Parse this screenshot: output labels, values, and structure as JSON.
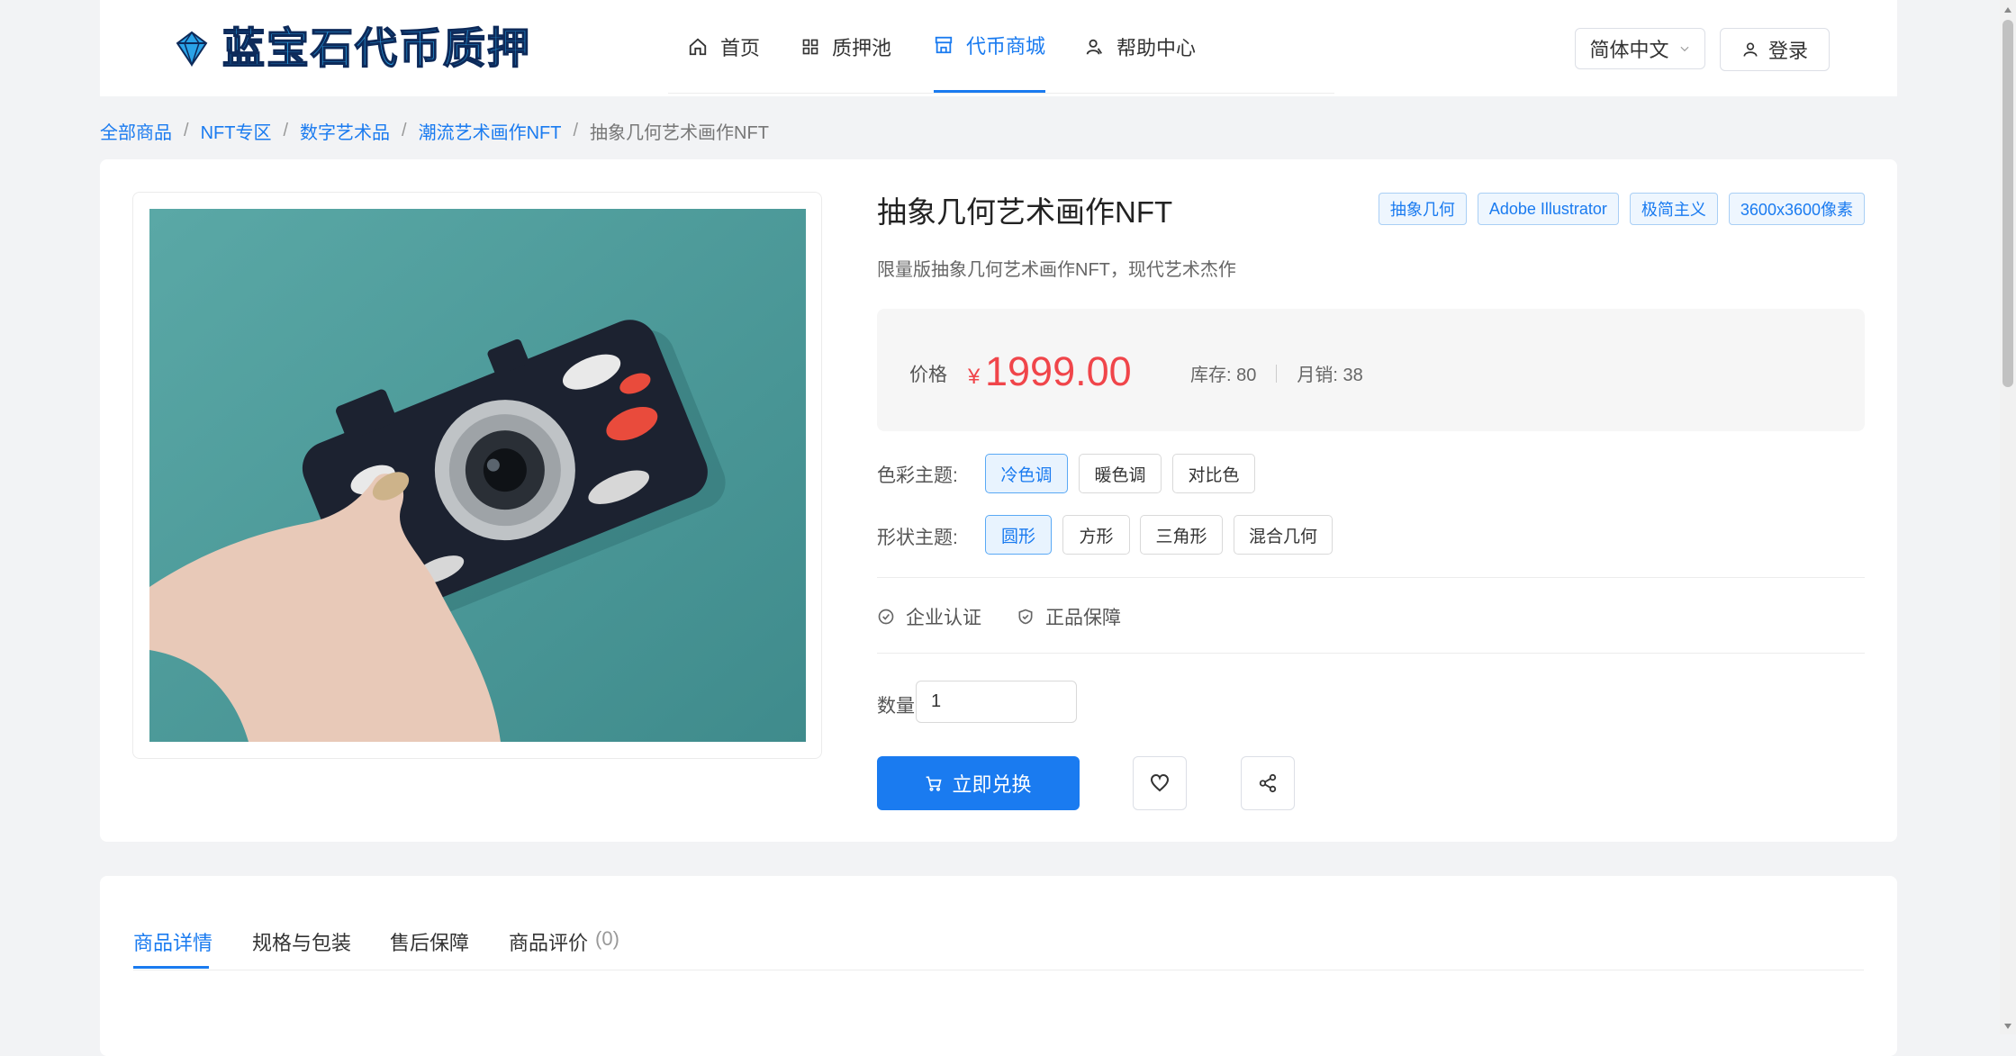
{
  "header": {
    "logo_text": "蓝宝石代币质押",
    "nav": [
      {
        "label": "首页",
        "icon": "home-icon"
      },
      {
        "label": "质押池",
        "icon": "grid-icon"
      },
      {
        "label": "代币商城",
        "icon": "store-icon",
        "active": true
      },
      {
        "label": "帮助中心",
        "icon": "support-icon"
      }
    ],
    "language": "简体中文",
    "login": "登录"
  },
  "breadcrumb": {
    "items": [
      "全部商品",
      "NFT专区",
      "数字艺术品",
      "潮流艺术画作NFT"
    ],
    "current": "抽象几何艺术画作NFT",
    "separator": "/"
  },
  "product": {
    "title": "抽象几何艺术画作NFT",
    "tags": [
      "抽象几何",
      "Adobe Illustrator",
      "极简主义",
      "3600x3600像素"
    ],
    "subtitle": "限量版抽象几何艺术画作NFT，现代艺术杰作",
    "price_label": "价格",
    "currency": "¥",
    "price": "1999.00",
    "stock": "库存: 80",
    "monthly_sales": "月销: 38",
    "color_theme_label": "色彩主题:",
    "color_options": [
      "冷色调",
      "暖色调",
      "对比色"
    ],
    "shape_theme_label": "形状主题:",
    "shape_options": [
      "圆形",
      "方形",
      "三角形",
      "混合几何"
    ],
    "cert_enterprise": "企业认证",
    "cert_genuine": "正品保障",
    "quantity_label": "数量",
    "quantity": "1",
    "buy_label": "立即兑换"
  },
  "tabs": {
    "items": [
      "商品详情",
      "规格与包装",
      "售后保障",
      "商品评价"
    ],
    "review_count": "(0)"
  },
  "colors": {
    "accent": "#1a7bf0",
    "price": "#f0454a",
    "photo_bg": "#4f9c9c"
  }
}
